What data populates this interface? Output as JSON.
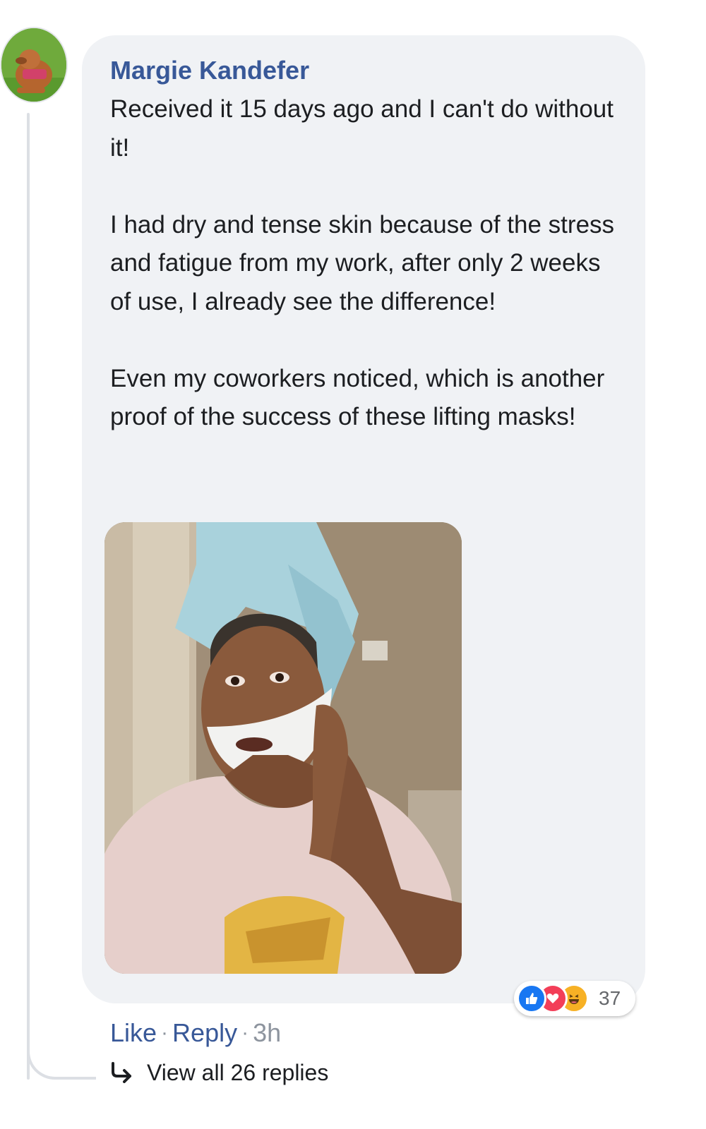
{
  "comment": {
    "author": "Margie Kandefer",
    "paragraphs": [
      "Received it 15 days ago and I can't do without it!",
      "I had dry and tense skin because of the stress and fatigue from my work, after only 2 weeks of use, I already see the difference!",
      "Even my coworkers noticed, which is another proof of the success of these lifting masks!"
    ],
    "reactions": {
      "icons": [
        "like-icon",
        "love-icon",
        "haha-icon"
      ],
      "count": "37"
    },
    "actions": {
      "like": "Like",
      "reply": "Reply",
      "separator": "·",
      "time": "3h"
    },
    "view_replies": "View all 26 replies"
  },
  "colors": {
    "author": "#385898",
    "bubble": "#f0f2f5",
    "like": "#1877f2",
    "love": "#f33e58",
    "haha": "#f7b125"
  }
}
